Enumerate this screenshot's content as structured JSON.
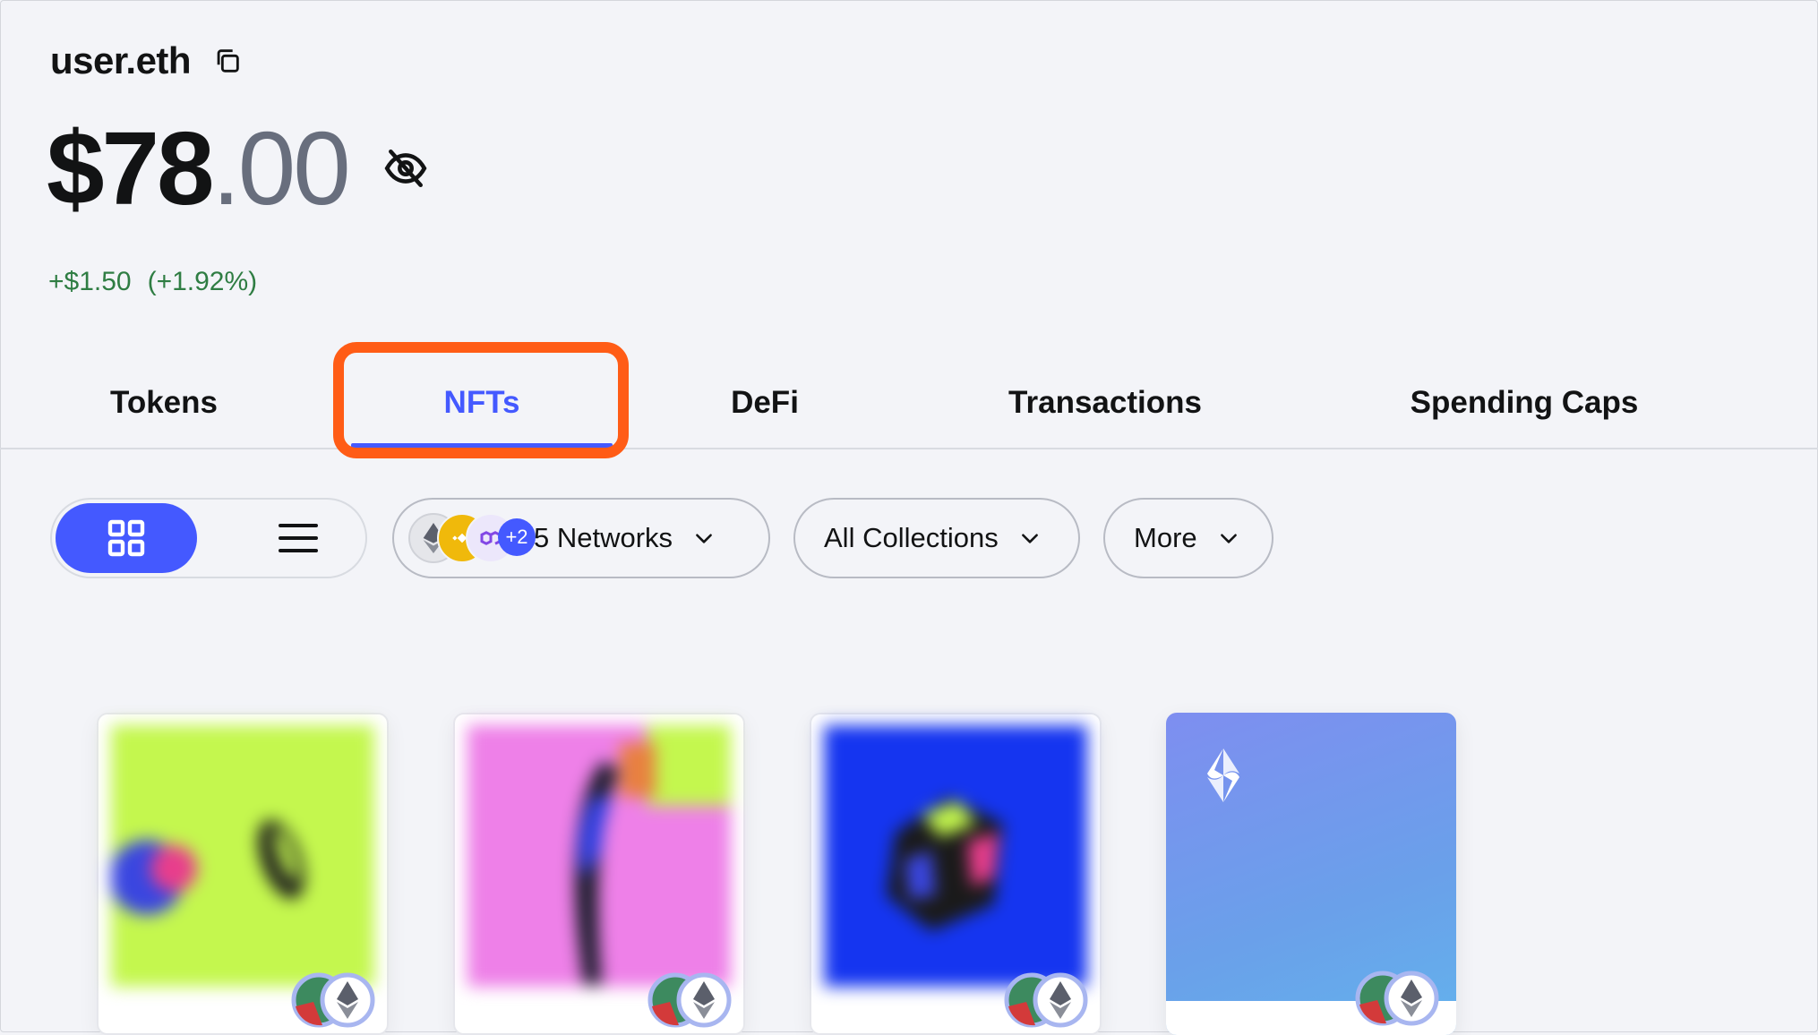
{
  "account": {
    "name": "user.eth"
  },
  "balance": {
    "integer": "$78",
    "decimal": ".00"
  },
  "change": {
    "amount": "+$1.50",
    "percent": "(+1.92%)"
  },
  "tabs": [
    {
      "label": "Tokens",
      "active": false
    },
    {
      "label": "NFTs",
      "active": true
    },
    {
      "label": "DeFi",
      "active": false
    },
    {
      "label": "Transactions",
      "active": false
    },
    {
      "label": "Spending Caps",
      "active": false
    }
  ],
  "toolbar": {
    "networks_label": "5 Networks",
    "networks_more": "+2",
    "collections_label": "All Collections",
    "more_label": "More"
  },
  "colors": {
    "accent": "#4459ff",
    "highlight": "#ff5c16",
    "positive": "#2f7d43",
    "nft_1": "#c4f74e",
    "nft_2": "#ee80e8",
    "nft_3": "#1535f0"
  },
  "icons": {
    "copy": "copy-icon",
    "hide": "eye-slash-icon",
    "grid": "grid-icon",
    "list": "list-icon",
    "chevron": "chevron-down-icon",
    "network": "ethereum-icon",
    "ens": "ens-logo-icon"
  }
}
